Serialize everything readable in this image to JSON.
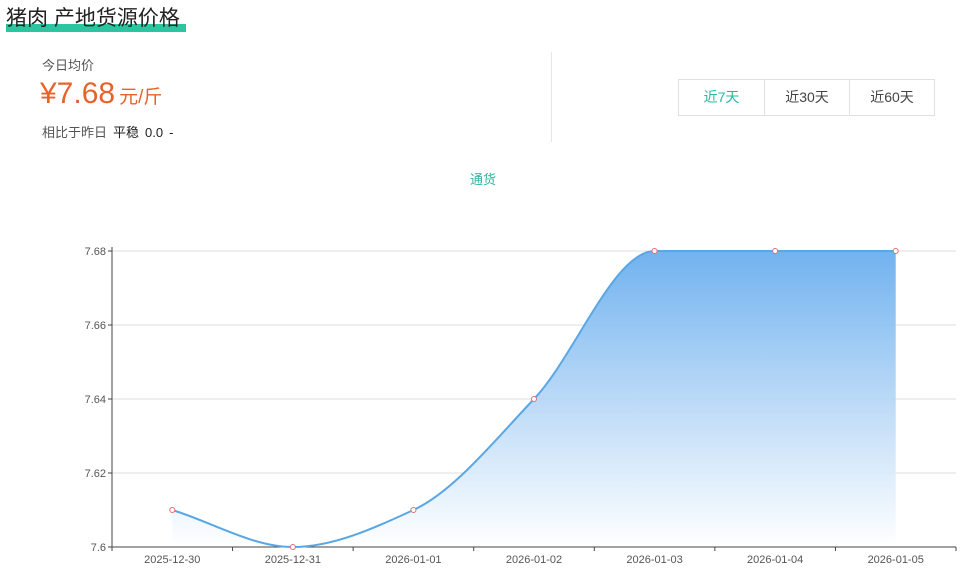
{
  "header": {
    "title": "猪肉 产地货源价格"
  },
  "summary": {
    "avg_label": "今日均价",
    "price": "¥7.68",
    "unit": "元/斤",
    "compare_label": "相比于昨日",
    "compare_status": "平稳",
    "compare_value": "0.0",
    "compare_dash": "-"
  },
  "tabs": [
    {
      "label": "近7天",
      "active": true
    },
    {
      "label": "近30天",
      "active": false
    },
    {
      "label": "近60天",
      "active": false
    }
  ],
  "colors": {
    "accent": "#2cb5a0",
    "price": "#e8622a",
    "line": "#5aa7e6",
    "area_top": "#6aaeee",
    "point": "#e07070"
  },
  "chart_data": {
    "type": "area",
    "series": [
      {
        "name": "通货",
        "values": [
          7.61,
          7.6,
          7.61,
          7.64,
          7.68,
          7.68,
          7.68
        ]
      }
    ],
    "x": [
      "2025-12-30",
      "2025-12-31",
      "2026-01-01",
      "2026-01-02",
      "2026-01-03",
      "2026-01-04",
      "2026-01-05"
    ],
    "ylim": [
      7.6,
      7.68
    ],
    "yticks": [
      "7.6",
      "7.62",
      "7.64",
      "7.66",
      "7.68"
    ],
    "smooth": true,
    "grid": true,
    "legend_position": "top-center"
  }
}
